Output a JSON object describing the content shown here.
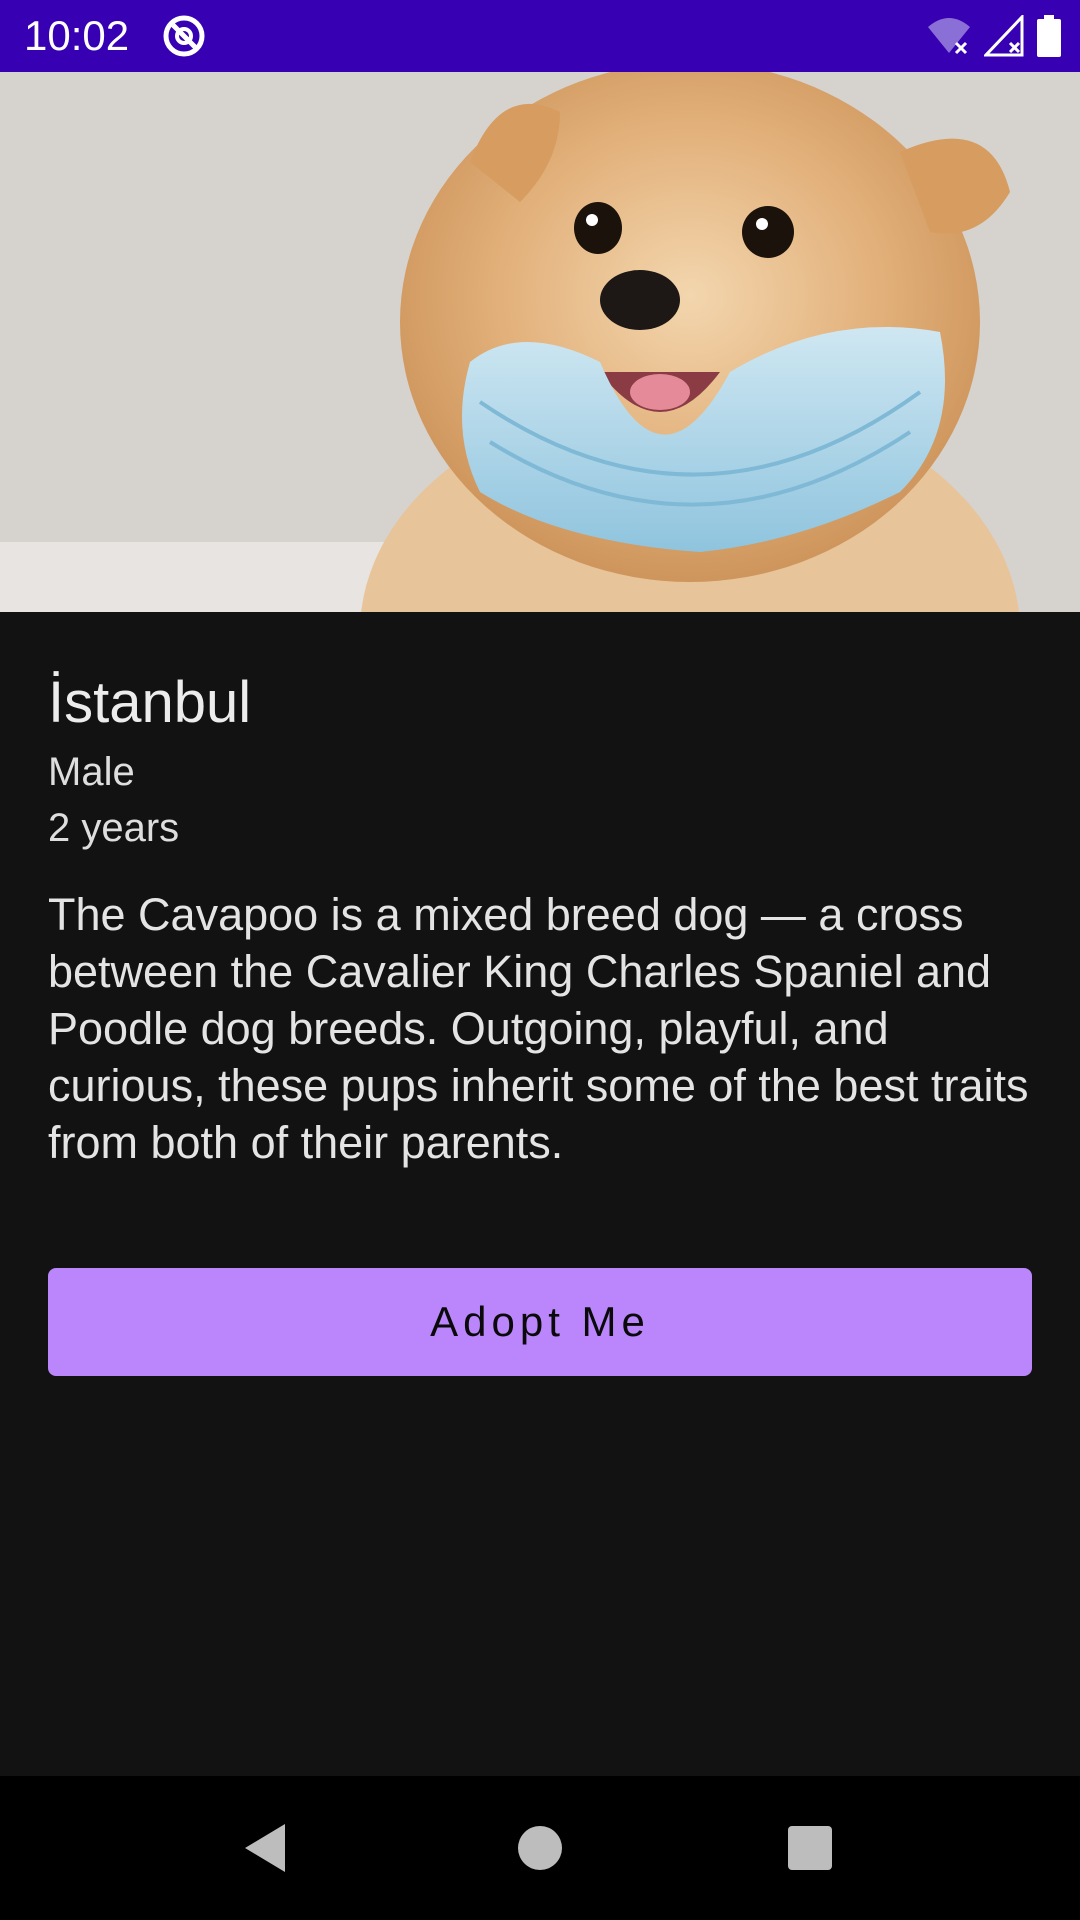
{
  "status_bar": {
    "time": "10:02",
    "icons": [
      "app-notification-icon",
      "wifi-off-icon",
      "signal-off-icon",
      "battery-icon"
    ],
    "background_color": "#3700b3"
  },
  "hero": {
    "image": "pomeranian-dog-with-face-mask-photo"
  },
  "pet": {
    "name": "İstanbul",
    "gender": "Male",
    "age": "2 years",
    "description": "The Cavapoo is a mixed breed dog — a cross between the Cavalier King Charles Spaniel and Poodle dog breeds. Outgoing, playful, and curious, these pups inherit some of the best traits from both of their parents."
  },
  "actions": {
    "adopt_label": "Adopt Me",
    "accent_color": "#bb86fc"
  },
  "nav_bar": {
    "icons": [
      "back-icon",
      "home-icon",
      "recents-icon"
    ]
  }
}
